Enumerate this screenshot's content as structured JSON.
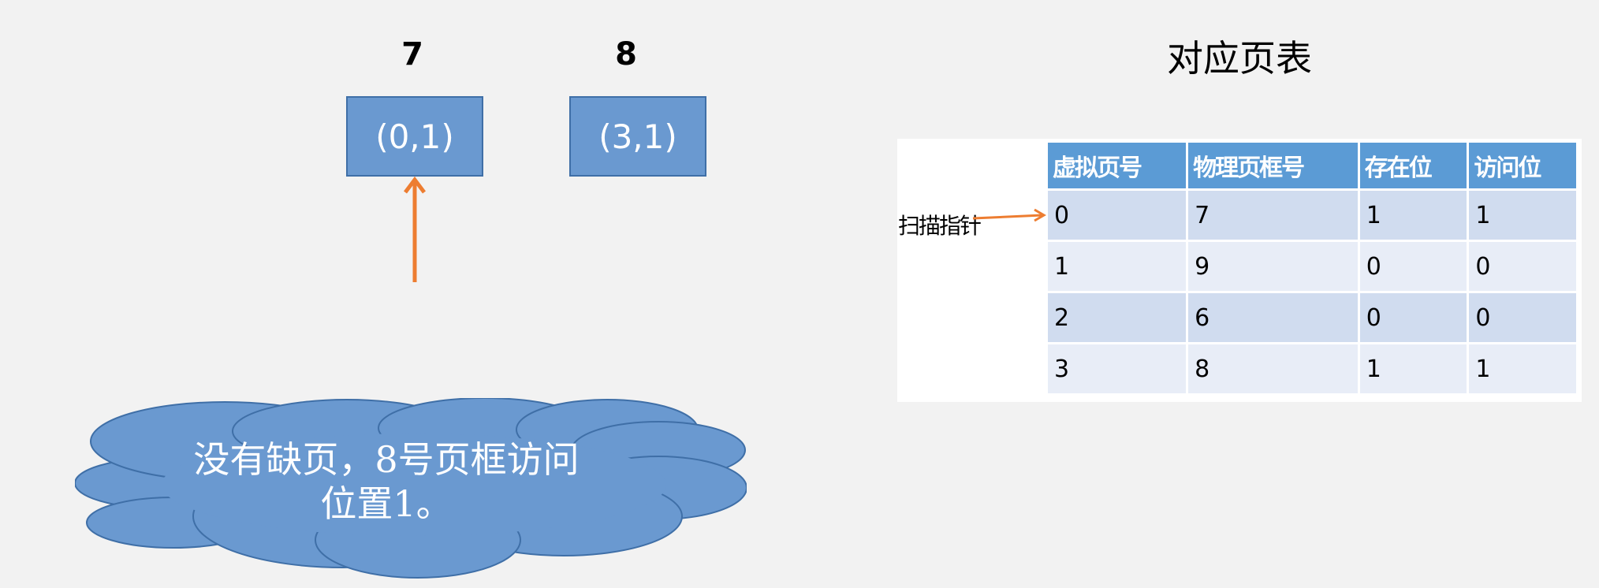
{
  "frames": [
    {
      "number": "7",
      "content": "(0,1)"
    },
    {
      "number": "8",
      "content": "(3,1)"
    }
  ],
  "callout": {
    "line1": "没有缺页，8号页框访问",
    "line2": "位置1。"
  },
  "table": {
    "title": "对应页表",
    "pointer_label": "扫描指针",
    "headers": [
      "虚拟页号",
      "物理页框号",
      "存在位",
      "访问位"
    ],
    "rows": [
      [
        "0",
        "7",
        "1",
        "1"
      ],
      [
        "1",
        "9",
        "0",
        "0"
      ],
      [
        "2",
        "6",
        "0",
        "0"
      ],
      [
        "3",
        "8",
        "1",
        "1"
      ]
    ]
  },
  "colors": {
    "box_fill": "#6a99d0",
    "arrow": "#ed7d31",
    "header_fill": "#5b9bd5"
  }
}
